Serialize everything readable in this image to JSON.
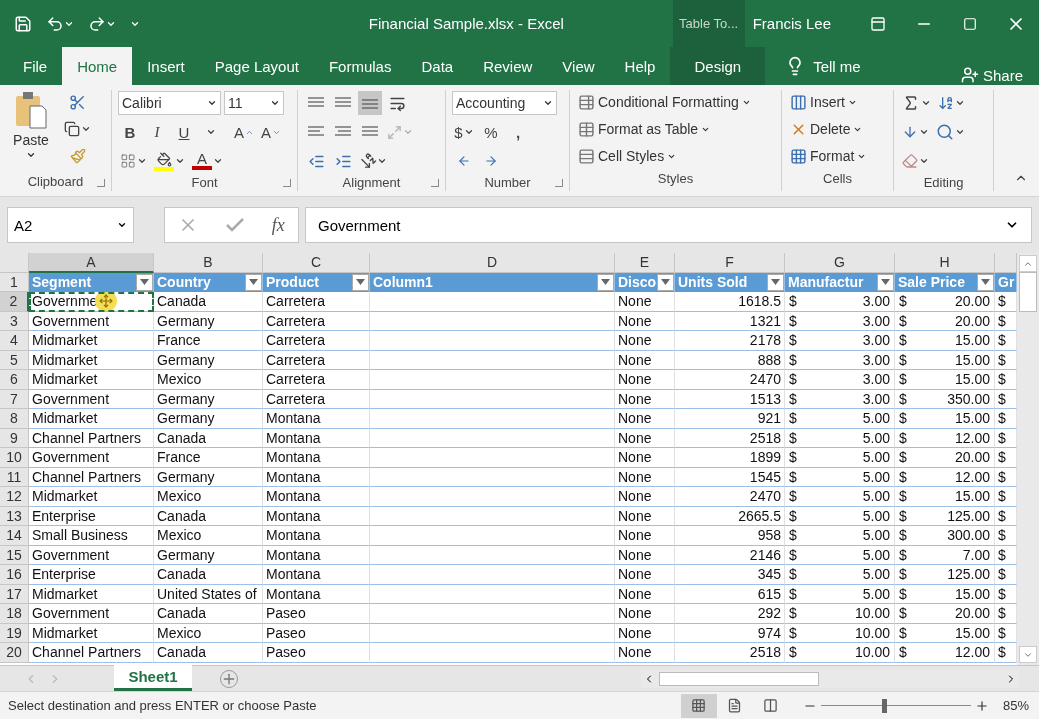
{
  "window": {
    "title": "Financial Sample.xlsx  -  Excel",
    "context_tab": "Table To...",
    "user": "Francis Lee"
  },
  "ribbon_tabs": [
    {
      "label": "File",
      "selected": false,
      "kind": "plain"
    },
    {
      "label": "Home",
      "selected": true,
      "kind": "plain"
    },
    {
      "label": "Insert",
      "selected": false,
      "kind": "plain"
    },
    {
      "label": "Page Layout",
      "selected": false,
      "kind": "plain"
    },
    {
      "label": "Formulas",
      "selected": false,
      "kind": "plain"
    },
    {
      "label": "Data",
      "selected": false,
      "kind": "plain"
    },
    {
      "label": "Review",
      "selected": false,
      "kind": "plain"
    },
    {
      "label": "View",
      "selected": false,
      "kind": "plain"
    },
    {
      "label": "Help",
      "selected": false,
      "kind": "plain"
    },
    {
      "label": "Design",
      "selected": false,
      "kind": "context"
    }
  ],
  "tell_me": "Tell me",
  "share": "Share",
  "ribbon": {
    "clipboard": {
      "label": "Clipboard",
      "paste": "Paste"
    },
    "font": {
      "label": "Font",
      "name": "Calibri",
      "size": "11",
      "styles": [
        "B",
        "I",
        "U"
      ],
      "grow": "A",
      "shrink": "A",
      "font_color_button": "A"
    },
    "alignment": {
      "label": "Alignment",
      "vertical": [
        {
          "selected": false
        },
        {
          "selected": false
        },
        {
          "selected": true
        }
      ]
    },
    "number": {
      "label": "Number",
      "format": "Accounting",
      "currency": "$",
      "percent": "%",
      "comma": ","
    },
    "styles": {
      "label": "Styles",
      "items": [
        "Conditional Formatting",
        "Format as Table",
        "Cell Styles"
      ]
    },
    "cells": {
      "label": "Cells",
      "items": [
        "Insert",
        "Delete",
        "Format"
      ]
    },
    "editing": {
      "label": "Editing"
    }
  },
  "formula_bar": {
    "name_box": "A2",
    "fx": "fx",
    "value": "Government"
  },
  "sheet": {
    "columns": [
      {
        "letter": "A",
        "selected": true
      },
      {
        "letter": "B",
        "selected": false
      },
      {
        "letter": "C",
        "selected": false
      },
      {
        "letter": "D",
        "selected": false
      },
      {
        "letter": "E",
        "selected": false
      },
      {
        "letter": "F",
        "selected": false
      },
      {
        "letter": "G",
        "selected": false
      },
      {
        "letter": "H",
        "selected": false
      },
      {
        "selected": false
      }
    ],
    "header_row": {
      "number": "1",
      "cells": [
        {
          "text": "Segment",
          "filter": true
        },
        {
          "text": "Country",
          "filter": true
        },
        {
          "text": "Product",
          "filter": true
        },
        {
          "text": "Column1",
          "filter": true
        },
        {
          "text": "Disco",
          "filter": true
        },
        {
          "text": "Units Sold",
          "filter": true
        },
        {
          "text": "Manufactur",
          "filter": true
        },
        {
          "text": "Sale Price",
          "filter": true
        },
        {
          "text": "Gr",
          "filter": false
        }
      ]
    },
    "rows": [
      {
        "number": "2",
        "selected": true,
        "cells": [
          "Governme",
          "Canada",
          "Carretera",
          "",
          "None",
          "1618.5",
          {
            "symbol": "$",
            "amount": "3.00"
          },
          {
            "symbol": "$",
            "amount": "20.00"
          },
          "$"
        ]
      },
      {
        "number": "3",
        "selected": false,
        "cells": [
          "Government",
          "Germany",
          "Carretera",
          "",
          "None",
          "1321",
          {
            "symbol": "$",
            "amount": "3.00"
          },
          {
            "symbol": "$",
            "amount": "20.00"
          },
          "$"
        ]
      },
      {
        "number": "4",
        "selected": false,
        "cells": [
          "Midmarket",
          "France",
          "Carretera",
          "",
          "None",
          "2178",
          {
            "symbol": "$",
            "amount": "3.00"
          },
          {
            "symbol": "$",
            "amount": "15.00"
          },
          "$"
        ]
      },
      {
        "number": "5",
        "selected": false,
        "cells": [
          "Midmarket",
          "Germany",
          "Carretera",
          "",
          "None",
          "888",
          {
            "symbol": "$",
            "amount": "3.00"
          },
          {
            "symbol": "$",
            "amount": "15.00"
          },
          "$"
        ]
      },
      {
        "number": "6",
        "selected": false,
        "cells": [
          "Midmarket",
          "Mexico",
          "Carretera",
          "",
          "None",
          "2470",
          {
            "symbol": "$",
            "amount": "3.00"
          },
          {
            "symbol": "$",
            "amount": "15.00"
          },
          "$"
        ]
      },
      {
        "number": "7",
        "selected": false,
        "cells": [
          "Government",
          "Germany",
          "Carretera",
          "",
          "None",
          "1513",
          {
            "symbol": "$",
            "amount": "3.00"
          },
          {
            "symbol": "$",
            "amount": "350.00"
          },
          "$"
        ]
      },
      {
        "number": "8",
        "selected": false,
        "cells": [
          "Midmarket",
          "Germany",
          "Montana",
          "",
          "None",
          "921",
          {
            "symbol": "$",
            "amount": "5.00"
          },
          {
            "symbol": "$",
            "amount": "15.00"
          },
          "$"
        ]
      },
      {
        "number": "9",
        "selected": false,
        "cells": [
          "Channel Partners",
          "Canada",
          "Montana",
          "",
          "None",
          "2518",
          {
            "symbol": "$",
            "amount": "5.00"
          },
          {
            "symbol": "$",
            "amount": "12.00"
          },
          "$"
        ]
      },
      {
        "number": "10",
        "selected": false,
        "cells": [
          "Government",
          "France",
          "Montana",
          "",
          "None",
          "1899",
          {
            "symbol": "$",
            "amount": "5.00"
          },
          {
            "symbol": "$",
            "amount": "20.00"
          },
          "$"
        ]
      },
      {
        "number": "11",
        "selected": false,
        "cells": [
          "Channel Partners",
          "Germany",
          "Montana",
          "",
          "None",
          "1545",
          {
            "symbol": "$",
            "amount": "5.00"
          },
          {
            "symbol": "$",
            "amount": "12.00"
          },
          "$"
        ]
      },
      {
        "number": "12",
        "selected": false,
        "cells": [
          "Midmarket",
          "Mexico",
          "Montana",
          "",
          "None",
          "2470",
          {
            "symbol": "$",
            "amount": "5.00"
          },
          {
            "symbol": "$",
            "amount": "15.00"
          },
          "$"
        ]
      },
      {
        "number": "13",
        "selected": false,
        "cells": [
          "Enterprise",
          "Canada",
          "Montana",
          "",
          "None",
          "2665.5",
          {
            "symbol": "$",
            "amount": "5.00"
          },
          {
            "symbol": "$",
            "amount": "125.00"
          },
          "$"
        ]
      },
      {
        "number": "14",
        "selected": false,
        "cells": [
          "Small Business",
          "Mexico",
          "Montana",
          "",
          "None",
          "958",
          {
            "symbol": "$",
            "amount": "5.00"
          },
          {
            "symbol": "$",
            "amount": "300.00"
          },
          "$"
        ]
      },
      {
        "number": "15",
        "selected": false,
        "cells": [
          "Government",
          "Germany",
          "Montana",
          "",
          "None",
          "2146",
          {
            "symbol": "$",
            "amount": "5.00"
          },
          {
            "symbol": "$",
            "amount": "7.00"
          },
          "$"
        ]
      },
      {
        "number": "16",
        "selected": false,
        "cells": [
          "Enterprise",
          "Canada",
          "Montana",
          "",
          "None",
          "345",
          {
            "symbol": "$",
            "amount": "5.00"
          },
          {
            "symbol": "$",
            "amount": "125.00"
          },
          "$"
        ]
      },
      {
        "number": "17",
        "selected": false,
        "cells": [
          "Midmarket",
          "United States of",
          "Montana",
          "",
          "None",
          "615",
          {
            "symbol": "$",
            "amount": "5.00"
          },
          {
            "symbol": "$",
            "amount": "15.00"
          },
          "$"
        ]
      },
      {
        "number": "18",
        "selected": false,
        "cells": [
          "Government",
          "Canada",
          "Paseo",
          "",
          "None",
          "292",
          {
            "symbol": "$",
            "amount": "10.00"
          },
          {
            "symbol": "$",
            "amount": "20.00"
          },
          "$"
        ]
      },
      {
        "number": "19",
        "selected": false,
        "cells": [
          "Midmarket",
          "Mexico",
          "Paseo",
          "",
          "None",
          "974",
          {
            "symbol": "$",
            "amount": "10.00"
          },
          {
            "symbol": "$",
            "amount": "15.00"
          },
          "$"
        ]
      },
      {
        "number": "20",
        "selected": false,
        "cells": [
          "Channel Partners",
          "Canada",
          "Paseo",
          "",
          "None",
          "2518",
          {
            "symbol": "$",
            "amount": "10.00"
          },
          {
            "symbol": "$",
            "amount": "12.00"
          },
          "$"
        ]
      }
    ]
  },
  "sheet_tabs": [
    {
      "label": "Sheet1",
      "selected": true
    }
  ],
  "status_bar": {
    "message": "Select destination and press ENTER or choose Paste",
    "views": [
      {
        "selected": true
      },
      {
        "selected": false
      },
      {
        "selected": false
      }
    ],
    "zoom": {
      "level": 0.42,
      "reading": "85%"
    }
  }
}
